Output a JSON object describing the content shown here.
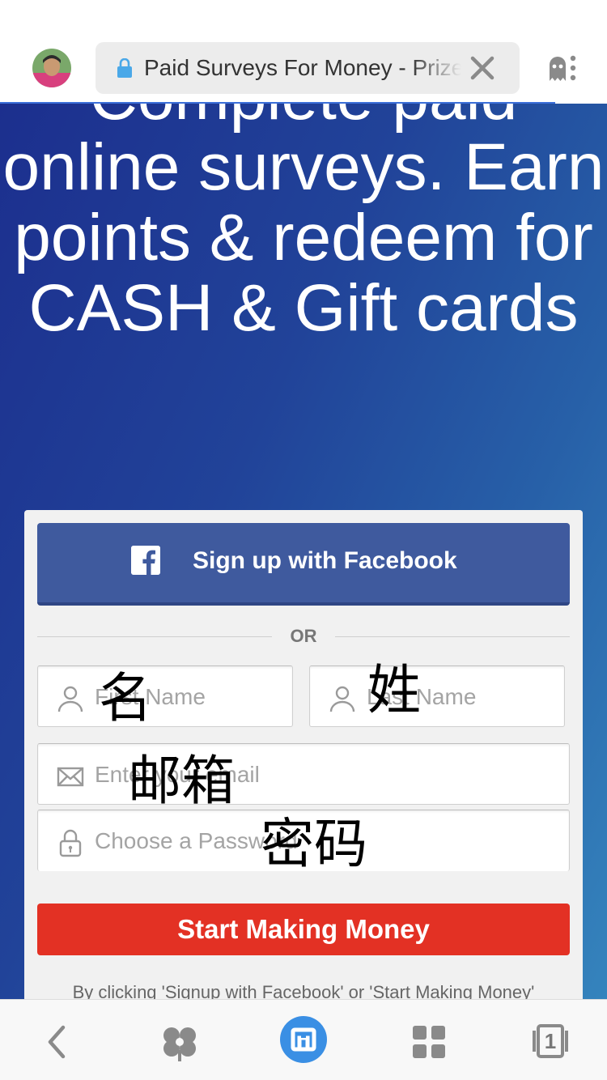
{
  "browser": {
    "url_title": "Paid Surveys For Money - Prize Rebel",
    "tab_count": "1"
  },
  "hero": {
    "headline": "Complete paid online surveys. Earn points & redeem for CASH & Gift cards"
  },
  "signup": {
    "facebook_label": "Sign up with Facebook",
    "or_label": "OR",
    "first_name_placeholder": "First Name",
    "last_name_placeholder": "Last Name",
    "email_placeholder": "Enter your email",
    "password_placeholder": "Choose a Password",
    "cta_label": "Start Making Money",
    "legal_text": "By clicking 'Signup with Facebook' or 'Start Making Money'"
  },
  "annotations": {
    "first_name": "名",
    "last_name": "姓",
    "email": "邮箱",
    "password": "密码"
  },
  "colors": {
    "facebook": "#3f5a9e",
    "cta": "#e33124",
    "accent": "#3a8fe4"
  },
  "icons": {
    "nav": [
      "back-icon",
      "clover-icon",
      "home-icon",
      "apps-grid-icon",
      "tabs-icon"
    ]
  }
}
